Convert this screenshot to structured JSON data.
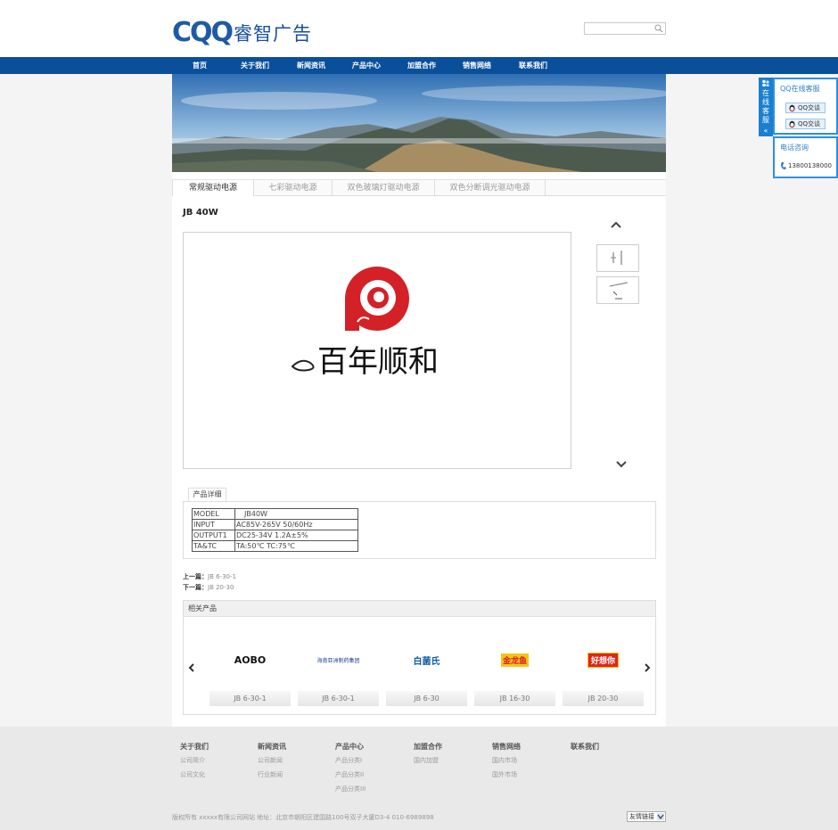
{
  "brand": {
    "logo_latin": "CQQ",
    "logo_cn": "睿智广告"
  },
  "search": {
    "placeholder": ""
  },
  "nav": {
    "items": [
      "首页",
      "关于我们",
      "新闻资讯",
      "产品中心",
      "加盟合作",
      "销售网络",
      "联系我们"
    ]
  },
  "tabs": [
    "常规驱动电源",
    "七彩驱动电源",
    "双色玻璃灯驱动电源",
    "双色分断调光驱动电源"
  ],
  "product": {
    "title": "JB 40W",
    "logo_text": "百年顺和"
  },
  "detail": {
    "tab_label": "产品详细",
    "spec": [
      [
        "MODEL",
        "JB40W"
      ],
      [
        "INPUT",
        "AC85V-265V 50/60Hz"
      ],
      [
        "OUTPUT1",
        "DC25-34V 1.2A±5%"
      ],
      [
        "TA&TC",
        "TA:50℃ TC:75℃"
      ]
    ]
  },
  "prev": {
    "label": "上一篇：",
    "value": "JB 6-30-1"
  },
  "next": {
    "label": "下一篇：",
    "value": "JB 20-30"
  },
  "related": {
    "header": "相关产品",
    "items": [
      {
        "name": "JB 6-30-1",
        "logo": "AOBO"
      },
      {
        "name": "JB 6-30-1",
        "logo": "海南亚洲制药集团"
      },
      {
        "name": "JB 6-30",
        "logo": "白菌氏"
      },
      {
        "name": "JB 16-30",
        "logo": "金龙鱼"
      },
      {
        "name": "JB 20-30",
        "logo": "好想你"
      }
    ]
  },
  "footer": {
    "columns": [
      {
        "title": "关于我们",
        "links": [
          "公司简介",
          "公司文化"
        ]
      },
      {
        "title": "新闻资讯",
        "links": [
          "公司新闻",
          "行业新闻"
        ]
      },
      {
        "title": "产品中心",
        "links": [
          "产品分类I",
          "产品分类II",
          "产品分类III"
        ]
      },
      {
        "title": "加盟合作",
        "links": [
          "国内加盟"
        ]
      },
      {
        "title": "销售网络",
        "links": [
          "国内市场",
          "国外市场"
        ]
      },
      {
        "title": "联系我们",
        "links": []
      }
    ],
    "copyright": "版权所有 xxxxx有限公司网站 地址：北京市朝阳区建国路100号双子大厦D3-4 010-6989898",
    "friend_links": "友情链接"
  },
  "side_service": {
    "strip": "在线客服",
    "qq_title": "QQ在线客服",
    "qq_buttons": [
      "QQ交谈",
      "QQ交谈"
    ],
    "phone_title": "电话咨询",
    "phone": "13800138000"
  },
  "colors": {
    "nav": "#0a4f9a",
    "brand": "#1f5aa6",
    "accent_red": "#d42027",
    "side_blue": "#2e8fe0"
  }
}
